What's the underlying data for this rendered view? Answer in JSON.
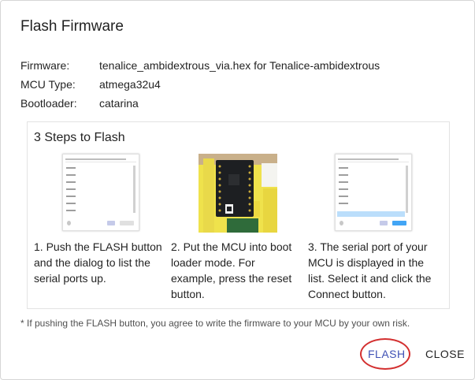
{
  "dialog": {
    "title": "Flash Firmware",
    "info": [
      {
        "key": "Firmware:",
        "value": "tenalice_ambidextrous_via.hex for Tenalice-ambidextrous"
      },
      {
        "key": "MCU Type:",
        "value": "atmega32u4"
      },
      {
        "key": "Bootloader:",
        "value": "catarina"
      }
    ],
    "steps": {
      "title": "3 Steps to Flash",
      "items": [
        {
          "text": "1. Push the FLASH button and the dialog to list the serial ports up."
        },
        {
          "text": "2. Put the MCU into boot loader mode. For example, press the reset button."
        },
        {
          "text": "3. The serial port of your MCU is displayed in the list. Select it and click the Connect button."
        }
      ]
    },
    "note": "* If pushing the FLASH button, you agree to write the firmware to your MCU by your own risk.",
    "buttons": {
      "flash": "FLASH",
      "close": "CLOSE"
    },
    "colors": {
      "primary": "#3f51b5",
      "highlight_circle": "#d32f2f"
    }
  }
}
